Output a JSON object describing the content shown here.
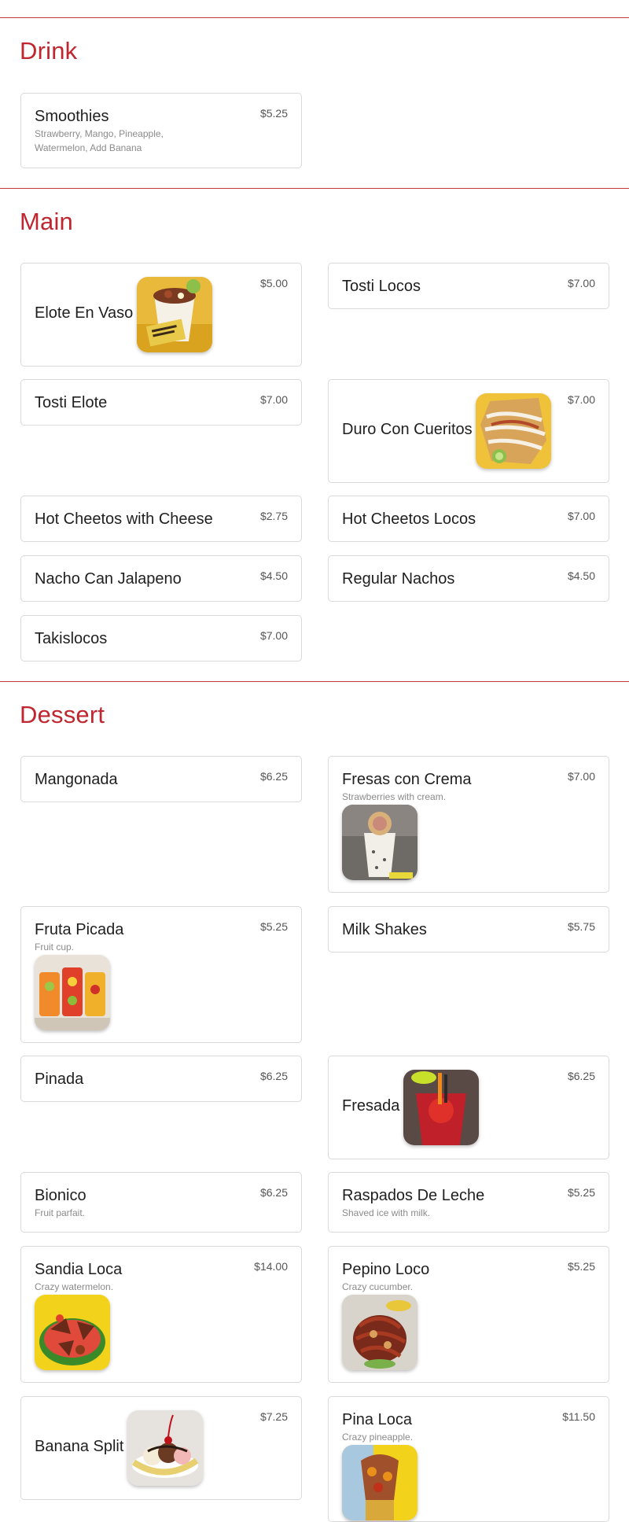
{
  "sections": {
    "drink": {
      "title": "Drink",
      "items": [
        {
          "name": "Smoothies",
          "price": "$5.25",
          "description": "Strawberry, Mango, Pineapple, Watermelon, Add Banana"
        }
      ]
    },
    "main": {
      "title": "Main",
      "items": [
        {
          "name": "Elote En Vaso",
          "price": "$5.00",
          "image_icon": "elote-cup-photo"
        },
        {
          "name": "Tosti Locos",
          "price": "$7.00"
        },
        {
          "name": "Tosti Elote",
          "price": "$7.00"
        },
        {
          "name": "Duro Con Cueritos",
          "price": "$7.00",
          "image_icon": "duro-photo"
        },
        {
          "name": "Hot Cheetos with Cheese",
          "price": "$2.75"
        },
        {
          "name": "Hot Cheetos Locos",
          "price": "$7.00"
        },
        {
          "name": "Nacho Can Jalapeno",
          "price": "$4.50"
        },
        {
          "name": "Regular Nachos",
          "price": "$4.50"
        },
        {
          "name": "Takislocos",
          "price": "$7.00"
        }
      ]
    },
    "dessert": {
      "title": "Dessert",
      "items": [
        {
          "name": "Mangonada",
          "price": "$6.25"
        },
        {
          "name": "Fresas con Crema",
          "price": "$7.00",
          "description": "Strawberries with cream.",
          "image_icon": "fresas-cup-photo"
        },
        {
          "name": "Fruta Picada",
          "price": "$5.25",
          "description": "Fruit cup.",
          "image_icon": "fruit-cups-photo"
        },
        {
          "name": "Milk Shakes",
          "price": "$5.75"
        },
        {
          "name": "Pinada",
          "price": "$6.25"
        },
        {
          "name": "Fresada",
          "price": "$6.25",
          "image_icon": "fresada-drink-photo"
        },
        {
          "name": "Bionico",
          "price": "$6.25",
          "description": "Fruit parfait."
        },
        {
          "name": "Raspados De Leche",
          "price": "$5.25",
          "description": "Shaved ice with milk."
        },
        {
          "name": "Sandia Loca",
          "price": "$14.00",
          "description": "Crazy watermelon.",
          "image_icon": "watermelon-photo"
        },
        {
          "name": "Pepino Loco",
          "price": "$5.25",
          "description": "Crazy cucumber.",
          "image_icon": "cucumber-photo"
        },
        {
          "name": "Banana Split",
          "price": "$7.25",
          "image_icon": "banana-split-photo"
        },
        {
          "name": "Pina Loca",
          "price": "$11.50",
          "description": "Crazy pineapple.",
          "image_icon": "pineapple-photo"
        }
      ]
    }
  },
  "colors": {
    "accent": "#c0262f",
    "divider": "#c0393f",
    "card_border": "#d9d9d9",
    "muted_text": "#8b8b8b"
  }
}
